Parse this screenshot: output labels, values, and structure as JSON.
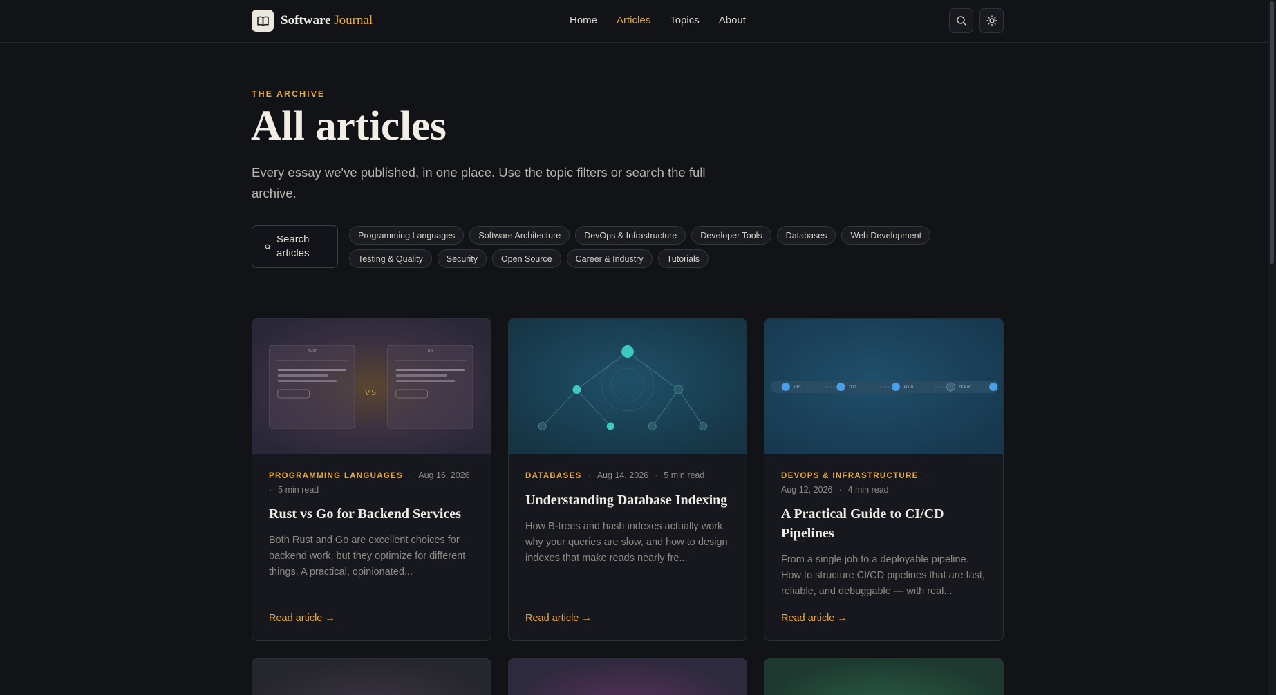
{
  "brand": {
    "name": "Software",
    "accent": "Journal",
    "logo_icon": "book-icon"
  },
  "nav": [
    {
      "label": "Home",
      "active": false
    },
    {
      "label": "Articles",
      "active": true
    },
    {
      "label": "Topics",
      "active": false
    },
    {
      "label": "About",
      "active": false
    }
  ],
  "header_actions": {
    "search_icon": "search-icon",
    "theme_icon": "sun-icon"
  },
  "hero": {
    "eyebrow": "THE ARCHIVE",
    "title": "All articles",
    "subtitle": "Every essay we've published, in one place. Use the topic filters or search the full archive."
  },
  "search": {
    "label": "Search articles"
  },
  "topics": [
    "Programming Languages",
    "Software Architecture",
    "DevOps & Infrastructure",
    "Developer Tools",
    "Databases",
    "Web Development",
    "Testing & Quality",
    "Security",
    "Open Source",
    "Career & Industry",
    "Tutorials"
  ],
  "cards": [
    {
      "category": "PROGRAMMING LANGUAGES",
      "date": "Aug 16, 2026",
      "read_time": "5 min read",
      "title": "Rust vs Go for Backend Services",
      "excerpt": "Both Rust and Go are excellent choices for backend work, but they optimize for different things. A practical, opinionated...",
      "cta": "Read article →",
      "illustration": {
        "left_label": "RUST",
        "right_label": "GO",
        "vs": "VS"
      }
    },
    {
      "category": "DATABASES",
      "date": "Aug 14, 2026",
      "read_time": "5 min read",
      "title": "Understanding Database Indexing",
      "excerpt": "How B-trees and hash indexes actually work, why your queries are slow, and how to design indexes that make reads nearly fre...",
      "cta": "Read article →"
    },
    {
      "category": "DEVOPS & INFRASTRUCTURE",
      "date": "Aug 12, 2026",
      "read_time": "4 min read",
      "title": "A Practical Guide to CI/CD Pipelines",
      "excerpt": "From a single job to a deployable pipeline. How to structure CI/CD pipelines that are fast, reliable, and debuggable — with real...",
      "cta": "Read article →",
      "illustration": {
        "stages": [
          "LINT",
          "TEST",
          "BUILD",
          "DEPLOY"
        ]
      }
    }
  ],
  "colors": {
    "accent": "#e9a93f",
    "background": "#111317",
    "teal": "#3ec9c0",
    "blue": "#4aa0e8"
  }
}
